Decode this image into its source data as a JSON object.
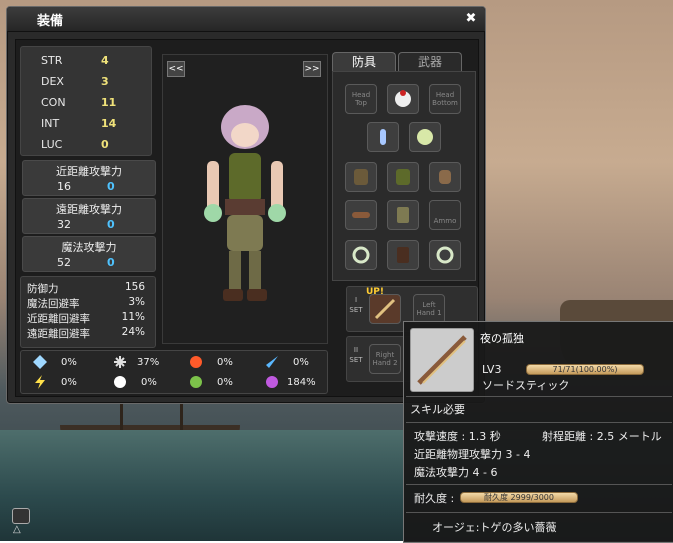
{
  "window": {
    "title": "装備",
    "close_glyph": "✖"
  },
  "stats": [
    {
      "label": "STR",
      "value": "4"
    },
    {
      "label": "DEX",
      "value": "3"
    },
    {
      "label": "CON",
      "value": "11"
    },
    {
      "label": "INT",
      "value": "14"
    },
    {
      "label": "LUC",
      "value": "0"
    }
  ],
  "attack": [
    {
      "label": "近距離攻撃力",
      "value": "16",
      "bonus": "0"
    },
    {
      "label": "遠距離攻撃力",
      "value": "32",
      "bonus": "0"
    },
    {
      "label": "魔法攻撃力",
      "value": "52",
      "bonus": "0"
    }
  ],
  "defense": [
    {
      "label": "防御力",
      "value": "156"
    },
    {
      "label": "魔法回避率",
      "value": "3%"
    },
    {
      "label": "近距離回避率",
      "value": "11%"
    },
    {
      "label": "遠距離回避率",
      "value": "24%"
    }
  ],
  "resists": [
    {
      "icon": "ice-crystal-icon",
      "value": "0%",
      "color": "#9fd8ff"
    },
    {
      "icon": "wind-icon",
      "value": "37%",
      "color": "#e0e0e0"
    },
    {
      "icon": "fire-icon",
      "value": "0%",
      "color": "#ff5a2a"
    },
    {
      "icon": "water-blade-icon",
      "value": "0%",
      "color": "#5ab8ff"
    },
    {
      "icon": "lightning-icon",
      "value": "0%",
      "color": "#ffe04a"
    },
    {
      "icon": "light-icon",
      "value": "0%",
      "color": "#ffffff"
    },
    {
      "icon": "earth-icon",
      "value": "0%",
      "color": "#7cc24a"
    },
    {
      "icon": "dark-icon",
      "value": "184%",
      "color": "#c05ae0"
    }
  ],
  "preview": {
    "prev_label": "<<",
    "next_label": ">>"
  },
  "tabs": [
    {
      "label": "防具"
    },
    {
      "label": "武器"
    }
  ],
  "slots": {
    "head_top": "Head\nTop",
    "head_bottom": "Head\nBottom",
    "ammo": "Ammo",
    "left_hand1": "Left\nHand 1",
    "right_hand2": "Right\nHand 2"
  },
  "sets": [
    {
      "label": "I\nSET"
    },
    {
      "label": "II\nSET"
    }
  ],
  "upgrade_badge": "UP!",
  "tooltip": {
    "name": "夜の孤独",
    "level": "LV3",
    "level_bar": "71/71(100.00%)",
    "type": "ソードスティック",
    "requirement": "スキル必要",
    "attack_speed": "攻撃速度 : 1.3 秒",
    "range": "射程距離 : 2.5 メートル",
    "melee": "近距離物理攻撃力 3 - 4",
    "magic": "魔法攻撃力 4 - 6",
    "durability_label": "耐久度 :",
    "durability_bar": "耐久度 2999/3000",
    "ouji": "オージェ:トゲの多い薔薇"
  }
}
